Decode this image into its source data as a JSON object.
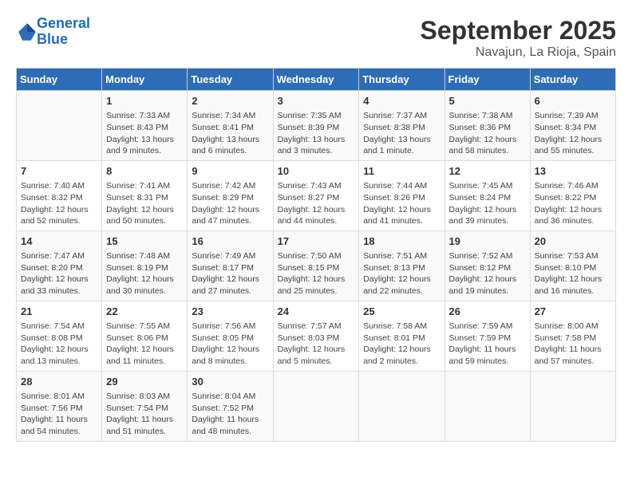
{
  "logo": {
    "line1": "General",
    "line2": "Blue"
  },
  "title": "September 2025",
  "location": "Navajun, La Rioja, Spain",
  "weekdays": [
    "Sunday",
    "Monday",
    "Tuesday",
    "Wednesday",
    "Thursday",
    "Friday",
    "Saturday"
  ],
  "weeks": [
    [
      {
        "day": "",
        "info": ""
      },
      {
        "day": "1",
        "info": "Sunrise: 7:33 AM\nSunset: 8:43 PM\nDaylight: 13 hours\nand 9 minutes."
      },
      {
        "day": "2",
        "info": "Sunrise: 7:34 AM\nSunset: 8:41 PM\nDaylight: 13 hours\nand 6 minutes."
      },
      {
        "day": "3",
        "info": "Sunrise: 7:35 AM\nSunset: 8:39 PM\nDaylight: 13 hours\nand 3 minutes."
      },
      {
        "day": "4",
        "info": "Sunrise: 7:37 AM\nSunset: 8:38 PM\nDaylight: 13 hours\nand 1 minute."
      },
      {
        "day": "5",
        "info": "Sunrise: 7:38 AM\nSunset: 8:36 PM\nDaylight: 12 hours\nand 58 minutes."
      },
      {
        "day": "6",
        "info": "Sunrise: 7:39 AM\nSunset: 8:34 PM\nDaylight: 12 hours\nand 55 minutes."
      }
    ],
    [
      {
        "day": "7",
        "info": "Sunrise: 7:40 AM\nSunset: 8:32 PM\nDaylight: 12 hours\nand 52 minutes."
      },
      {
        "day": "8",
        "info": "Sunrise: 7:41 AM\nSunset: 8:31 PM\nDaylight: 12 hours\nand 50 minutes."
      },
      {
        "day": "9",
        "info": "Sunrise: 7:42 AM\nSunset: 8:29 PM\nDaylight: 12 hours\nand 47 minutes."
      },
      {
        "day": "10",
        "info": "Sunrise: 7:43 AM\nSunset: 8:27 PM\nDaylight: 12 hours\nand 44 minutes."
      },
      {
        "day": "11",
        "info": "Sunrise: 7:44 AM\nSunset: 8:26 PM\nDaylight: 12 hours\nand 41 minutes."
      },
      {
        "day": "12",
        "info": "Sunrise: 7:45 AM\nSunset: 8:24 PM\nDaylight: 12 hours\nand 39 minutes."
      },
      {
        "day": "13",
        "info": "Sunrise: 7:46 AM\nSunset: 8:22 PM\nDaylight: 12 hours\nand 36 minutes."
      }
    ],
    [
      {
        "day": "14",
        "info": "Sunrise: 7:47 AM\nSunset: 8:20 PM\nDaylight: 12 hours\nand 33 minutes."
      },
      {
        "day": "15",
        "info": "Sunrise: 7:48 AM\nSunset: 8:19 PM\nDaylight: 12 hours\nand 30 minutes."
      },
      {
        "day": "16",
        "info": "Sunrise: 7:49 AM\nSunset: 8:17 PM\nDaylight: 12 hours\nand 27 minutes."
      },
      {
        "day": "17",
        "info": "Sunrise: 7:50 AM\nSunset: 8:15 PM\nDaylight: 12 hours\nand 25 minutes."
      },
      {
        "day": "18",
        "info": "Sunrise: 7:51 AM\nSunset: 8:13 PM\nDaylight: 12 hours\nand 22 minutes."
      },
      {
        "day": "19",
        "info": "Sunrise: 7:52 AM\nSunset: 8:12 PM\nDaylight: 12 hours\nand 19 minutes."
      },
      {
        "day": "20",
        "info": "Sunrise: 7:53 AM\nSunset: 8:10 PM\nDaylight: 12 hours\nand 16 minutes."
      }
    ],
    [
      {
        "day": "21",
        "info": "Sunrise: 7:54 AM\nSunset: 8:08 PM\nDaylight: 12 hours\nand 13 minutes."
      },
      {
        "day": "22",
        "info": "Sunrise: 7:55 AM\nSunset: 8:06 PM\nDaylight: 12 hours\nand 11 minutes."
      },
      {
        "day": "23",
        "info": "Sunrise: 7:56 AM\nSunset: 8:05 PM\nDaylight: 12 hours\nand 8 minutes."
      },
      {
        "day": "24",
        "info": "Sunrise: 7:57 AM\nSunset: 8:03 PM\nDaylight: 12 hours\nand 5 minutes."
      },
      {
        "day": "25",
        "info": "Sunrise: 7:58 AM\nSunset: 8:01 PM\nDaylight: 12 hours\nand 2 minutes."
      },
      {
        "day": "26",
        "info": "Sunrise: 7:59 AM\nSunset: 7:59 PM\nDaylight: 11 hours\nand 59 minutes."
      },
      {
        "day": "27",
        "info": "Sunrise: 8:00 AM\nSunset: 7:58 PM\nDaylight: 11 hours\nand 57 minutes."
      }
    ],
    [
      {
        "day": "28",
        "info": "Sunrise: 8:01 AM\nSunset: 7:56 PM\nDaylight: 11 hours\nand 54 minutes."
      },
      {
        "day": "29",
        "info": "Sunrise: 8:03 AM\nSunset: 7:54 PM\nDaylight: 11 hours\nand 51 minutes."
      },
      {
        "day": "30",
        "info": "Sunrise: 8:04 AM\nSunset: 7:52 PM\nDaylight: 11 hours\nand 48 minutes."
      },
      {
        "day": "",
        "info": ""
      },
      {
        "day": "",
        "info": ""
      },
      {
        "day": "",
        "info": ""
      },
      {
        "day": "",
        "info": ""
      }
    ]
  ]
}
